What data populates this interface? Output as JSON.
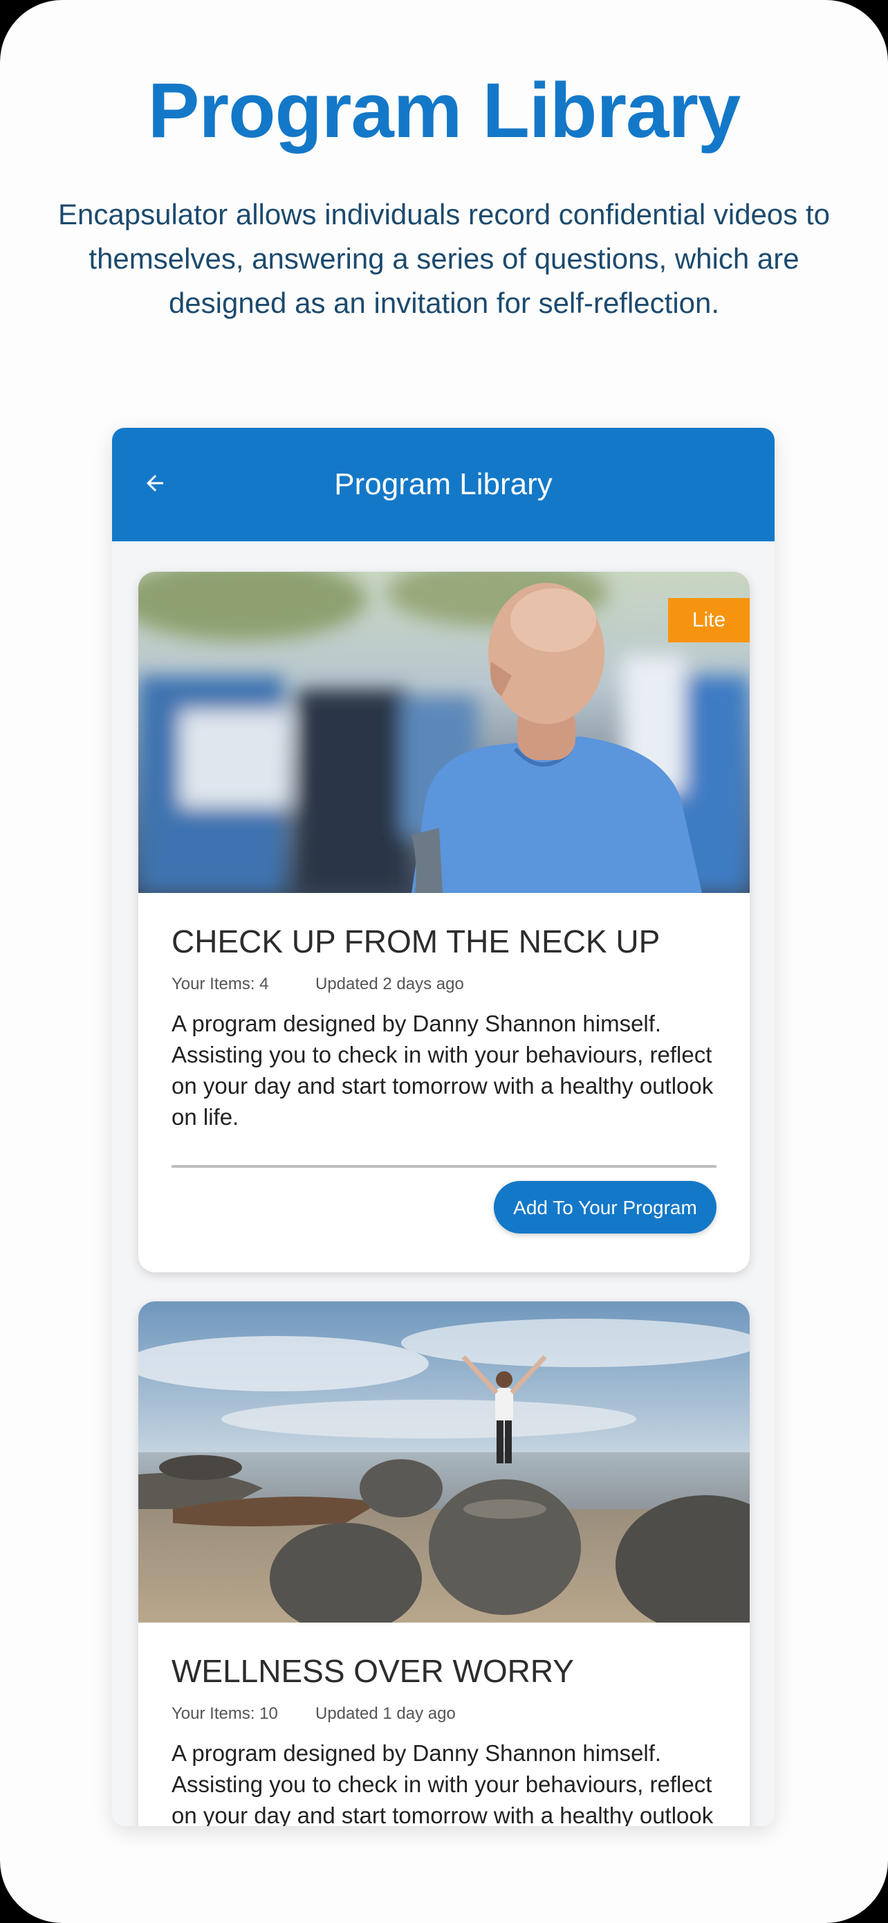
{
  "promo": {
    "title": "Program Library",
    "description": "Encapsulator allows individuals record confidential videos to themselves, answering a series of questions, which are designed as an invitation for self-reflection."
  },
  "appbar": {
    "title": "Program Library",
    "back_icon": "arrow-left-icon"
  },
  "colors": {
    "primary": "#1478c8",
    "badge": "#f7940f",
    "headline": "#1478c8"
  },
  "programs": [
    {
      "badge": "Lite",
      "title": "CHECK UP FROM THE NECK UP",
      "items": "Your Items: 4",
      "updated": "Updated 2 days ago",
      "description": "A program designed by Danny Shannon himself. Assisting you to check in with your behaviours, reflect on your day and start tomorrow with a healthy outlook on life.",
      "button_label": "Add To Your Program"
    },
    {
      "title": "WELLNESS OVER WORRY",
      "items": "Your Items: 10",
      "updated": "Updated 1 day ago",
      "description": "A program designed by Danny Shannon himself. Assisting you to check in with your behaviours, reflect on your day and start tomorrow with a healthy outlook"
    }
  ]
}
